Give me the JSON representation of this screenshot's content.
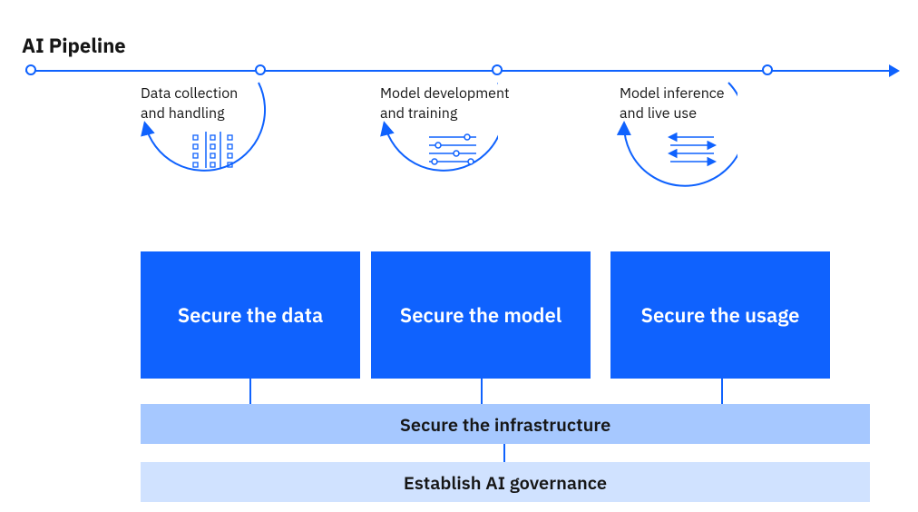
{
  "title": "AI Pipeline",
  "stages": [
    {
      "label": "Data collection\nand handling",
      "pillar": "Secure the data",
      "icon": "matrix-icon"
    },
    {
      "label": "Model development\nand training",
      "pillar": "Secure the model",
      "icon": "sliders-icon"
    },
    {
      "label": "Model inference\nand live use",
      "pillar": "Secure the usage",
      "icon": "flows-icon"
    }
  ],
  "layers": {
    "infrastructure": "Secure the infrastructure",
    "governance": "Establish AI governance"
  },
  "colors": {
    "brand": "#0f62fe",
    "infra": "#a6c8ff",
    "gov": "#d0e2ff",
    "text": "#161616"
  }
}
